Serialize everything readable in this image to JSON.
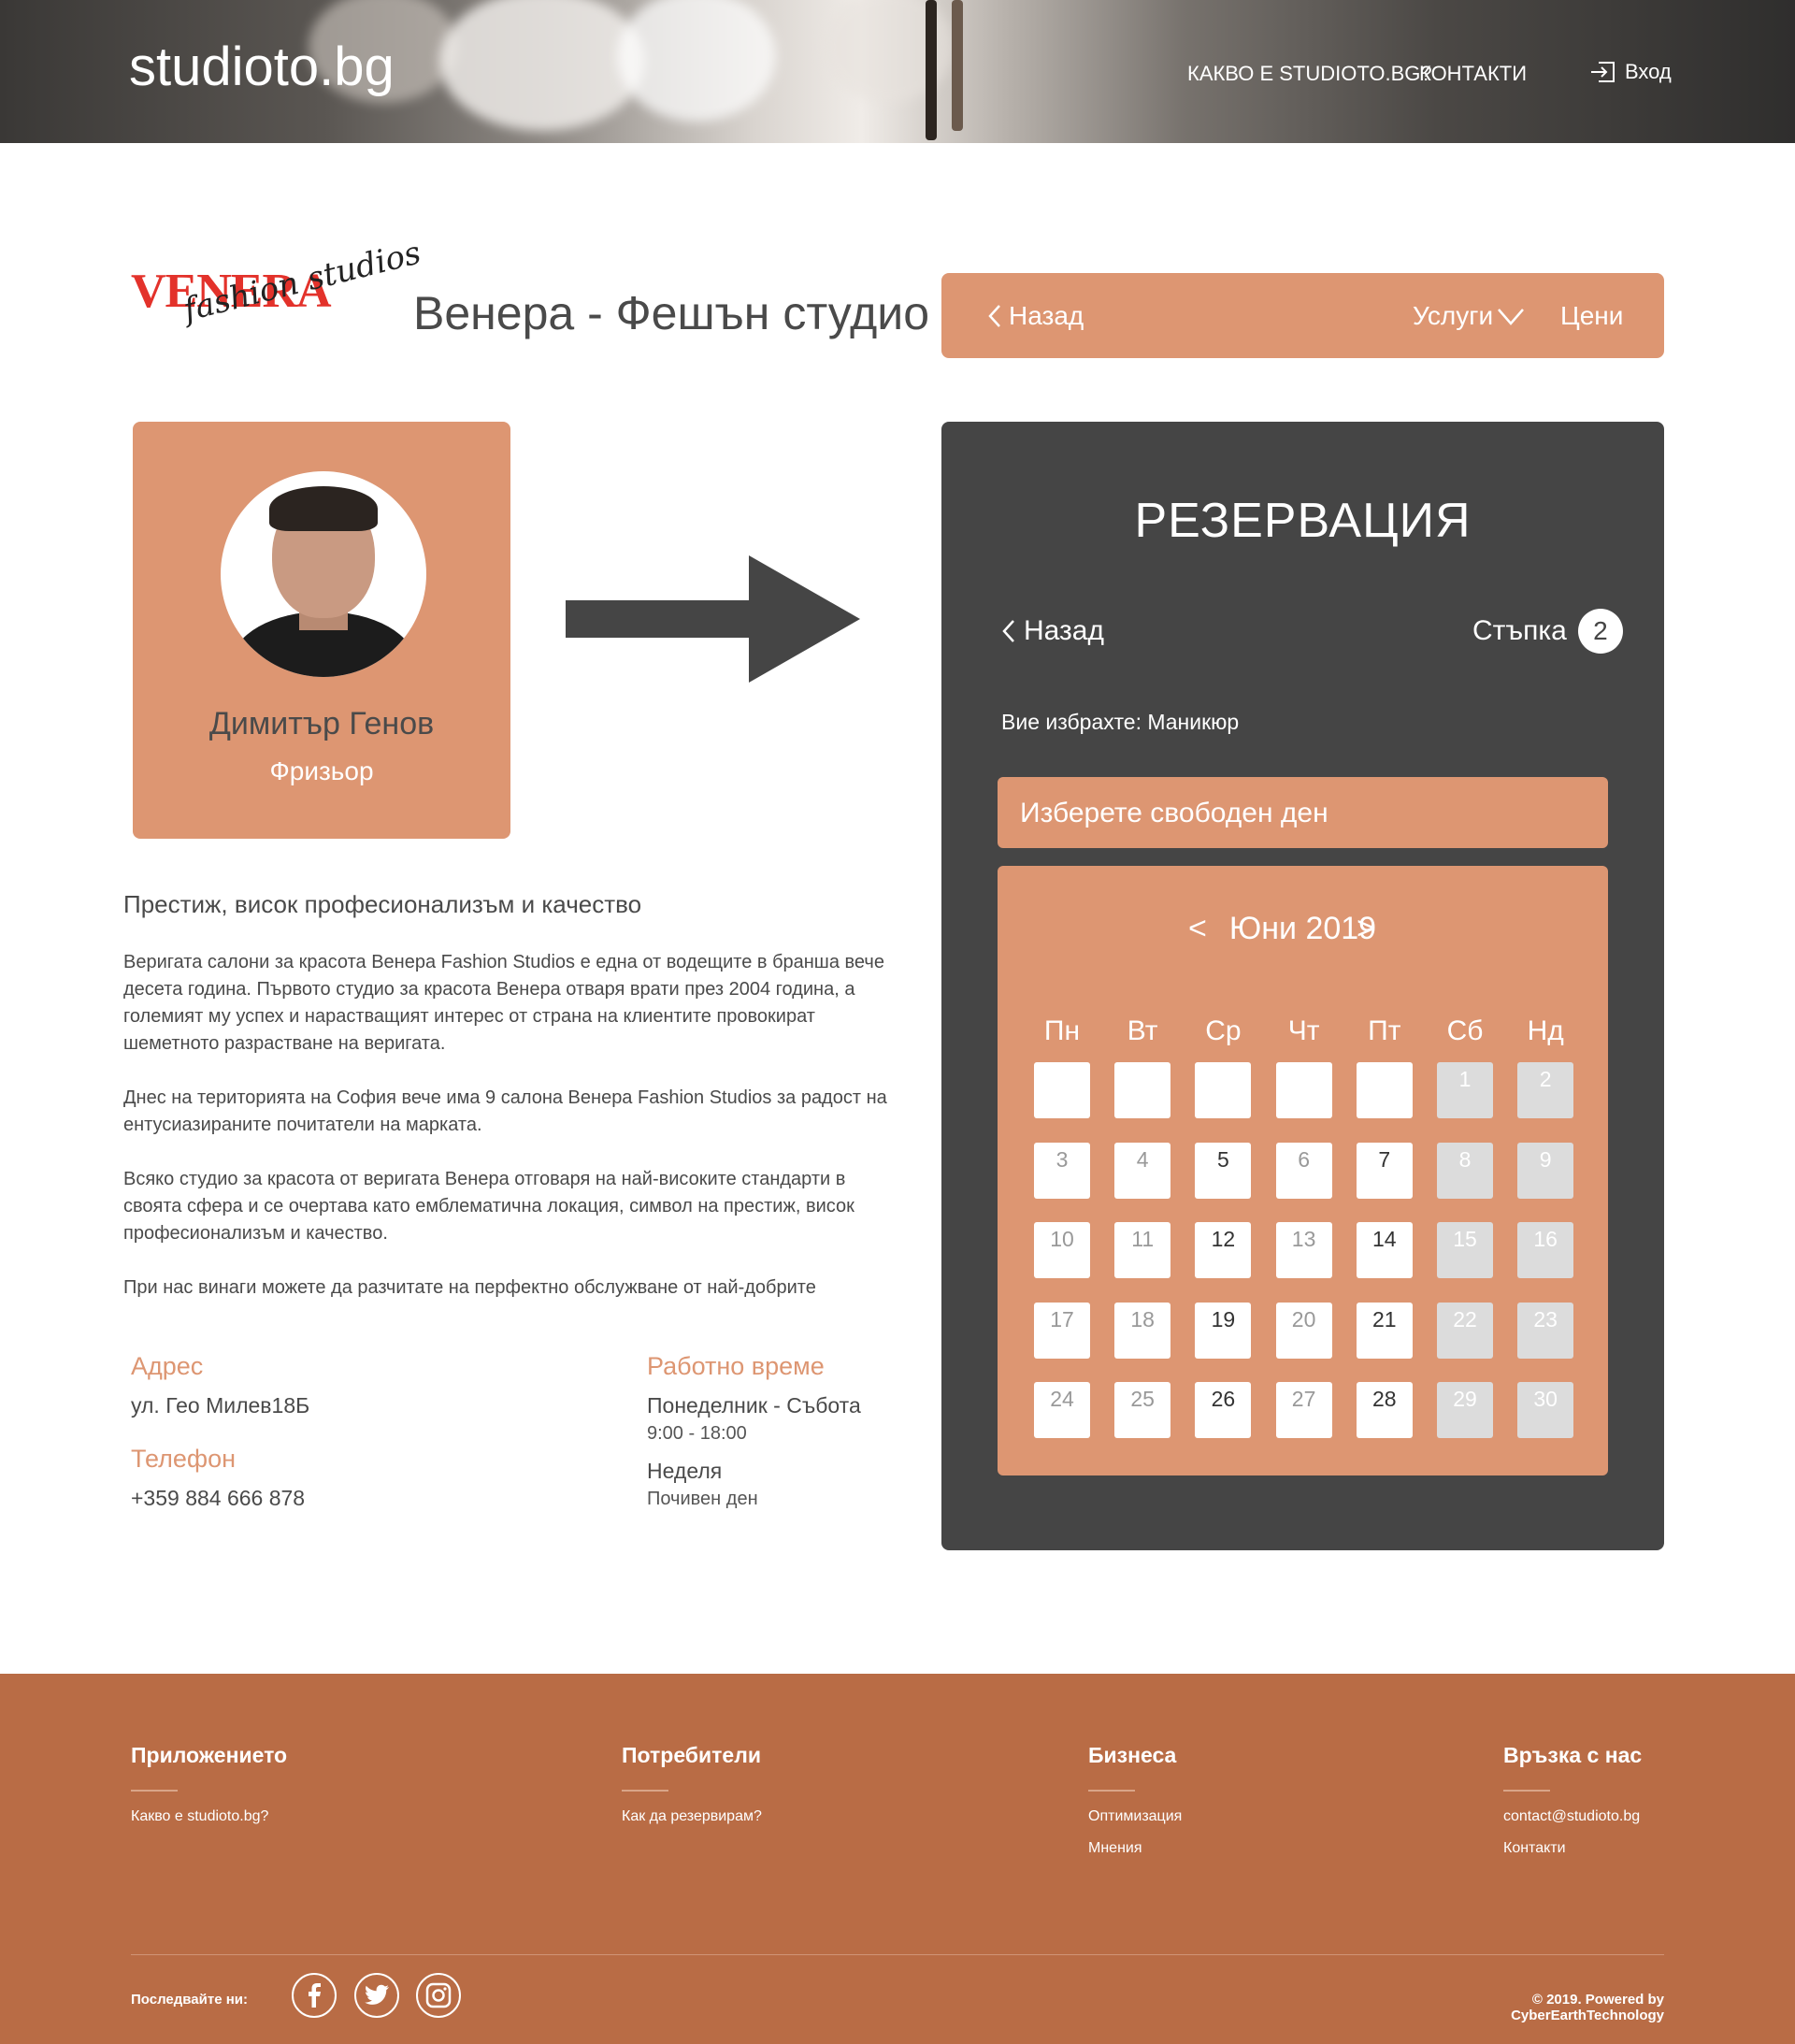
{
  "header": {
    "logo": "studioto.bg",
    "nav": [
      "КАКВО Е STUDIOTO.BG?",
      "КОНТАКТИ"
    ],
    "login": "Вход"
  },
  "studio": {
    "brand_name": "VENERA",
    "brand_script": "fashion studios",
    "title": "Венера - Фешън студио"
  },
  "top_bar": {
    "back": "Назад",
    "services": "Услуги",
    "prices": "Цени"
  },
  "profile": {
    "name": "Димитър Генов",
    "role": "Фризьор"
  },
  "about": {
    "title": "Престиж, висок професионализъм и качество",
    "paragraphs": [
      "Веригата салони за красота Венера Fashion Studios е една от водещите в бранша вече десета година. Първото студио за красота Венера отваря врати през 2004 година, а големият му успех и нарастващият интерес от страна на клиентите провокират шеметното разрастване на веригата.",
      "Днес на територията на София вече има 9 салона Венера Fashion Studios за радост на ентусиазираните почитатели на марката.",
      "Всяко студио за красота от веригата Венера отговаря на най-високите стандарти в своята сфера и се очертава като емблематична локация, символ на престиж, висок професионализъм и качество.",
      "При нас винаги можете да разчитате на перфектно обслужване от най-добрите"
    ]
  },
  "info": {
    "address_label": "Адрес",
    "address": "ул. Гео Милев18Б",
    "phone_label": "Телефон",
    "phone": "+359 884 666 878",
    "hours_label": "Работно време",
    "weekdays": "Понеделник - Събота",
    "weekdays_hours": "9:00 - 18:00",
    "sunday": "Неделя",
    "sunday_hours": "Почивен ден"
  },
  "reservation": {
    "heading": "РЕЗЕРВАЦИЯ",
    "back": "Назад",
    "step_label": "Стъпка",
    "step_number": "2",
    "chosen": "Вие избрахте: Маникюр",
    "choose_day": "Изберете свободен ден",
    "month": "Юни 2019",
    "prev": "<",
    "next": ">",
    "weekdays": [
      "Пн",
      "Вт",
      "Ср",
      "Чт",
      "Пт",
      "Сб",
      "Нд"
    ],
    "weeks": [
      [
        "",
        "",
        "",
        "",
        "",
        "1",
        "2"
      ],
      [
        "3",
        "4",
        "5",
        "6",
        "7",
        "8",
        "9"
      ],
      [
        "10",
        "11",
        "12",
        "13",
        "14",
        "15",
        "16"
      ],
      [
        "17",
        "18",
        "19",
        "20",
        "21",
        "22",
        "23"
      ],
      [
        "24",
        "25",
        "26",
        "27",
        "28",
        "29",
        "30"
      ]
    ],
    "available_days": [
      "5",
      "7",
      "12",
      "14",
      "19",
      "21",
      "26",
      "28"
    ]
  },
  "footer": {
    "columns": [
      {
        "title": "Приложението",
        "links": [
          "Какво е studioto.bg?"
        ]
      },
      {
        "title": "Потребители",
        "links": [
          "Как да резервирам?"
        ]
      },
      {
        "title": "Бизнеса",
        "links": [
          "Оптимизация",
          "Мнения"
        ]
      },
      {
        "title": "Връзка с нас",
        "links": [
          "contact@studioto.bg",
          "Контакти"
        ]
      }
    ],
    "follow": "Последвайте ни:",
    "social": [
      "facebook-icon",
      "twitter-icon",
      "instagram-icon"
    ],
    "copyright": "© 2019. Powered by CyberEarthTechnology"
  },
  "colors": {
    "accent": "#dd9672",
    "panel": "#454545",
    "footer": "#b96c45"
  }
}
